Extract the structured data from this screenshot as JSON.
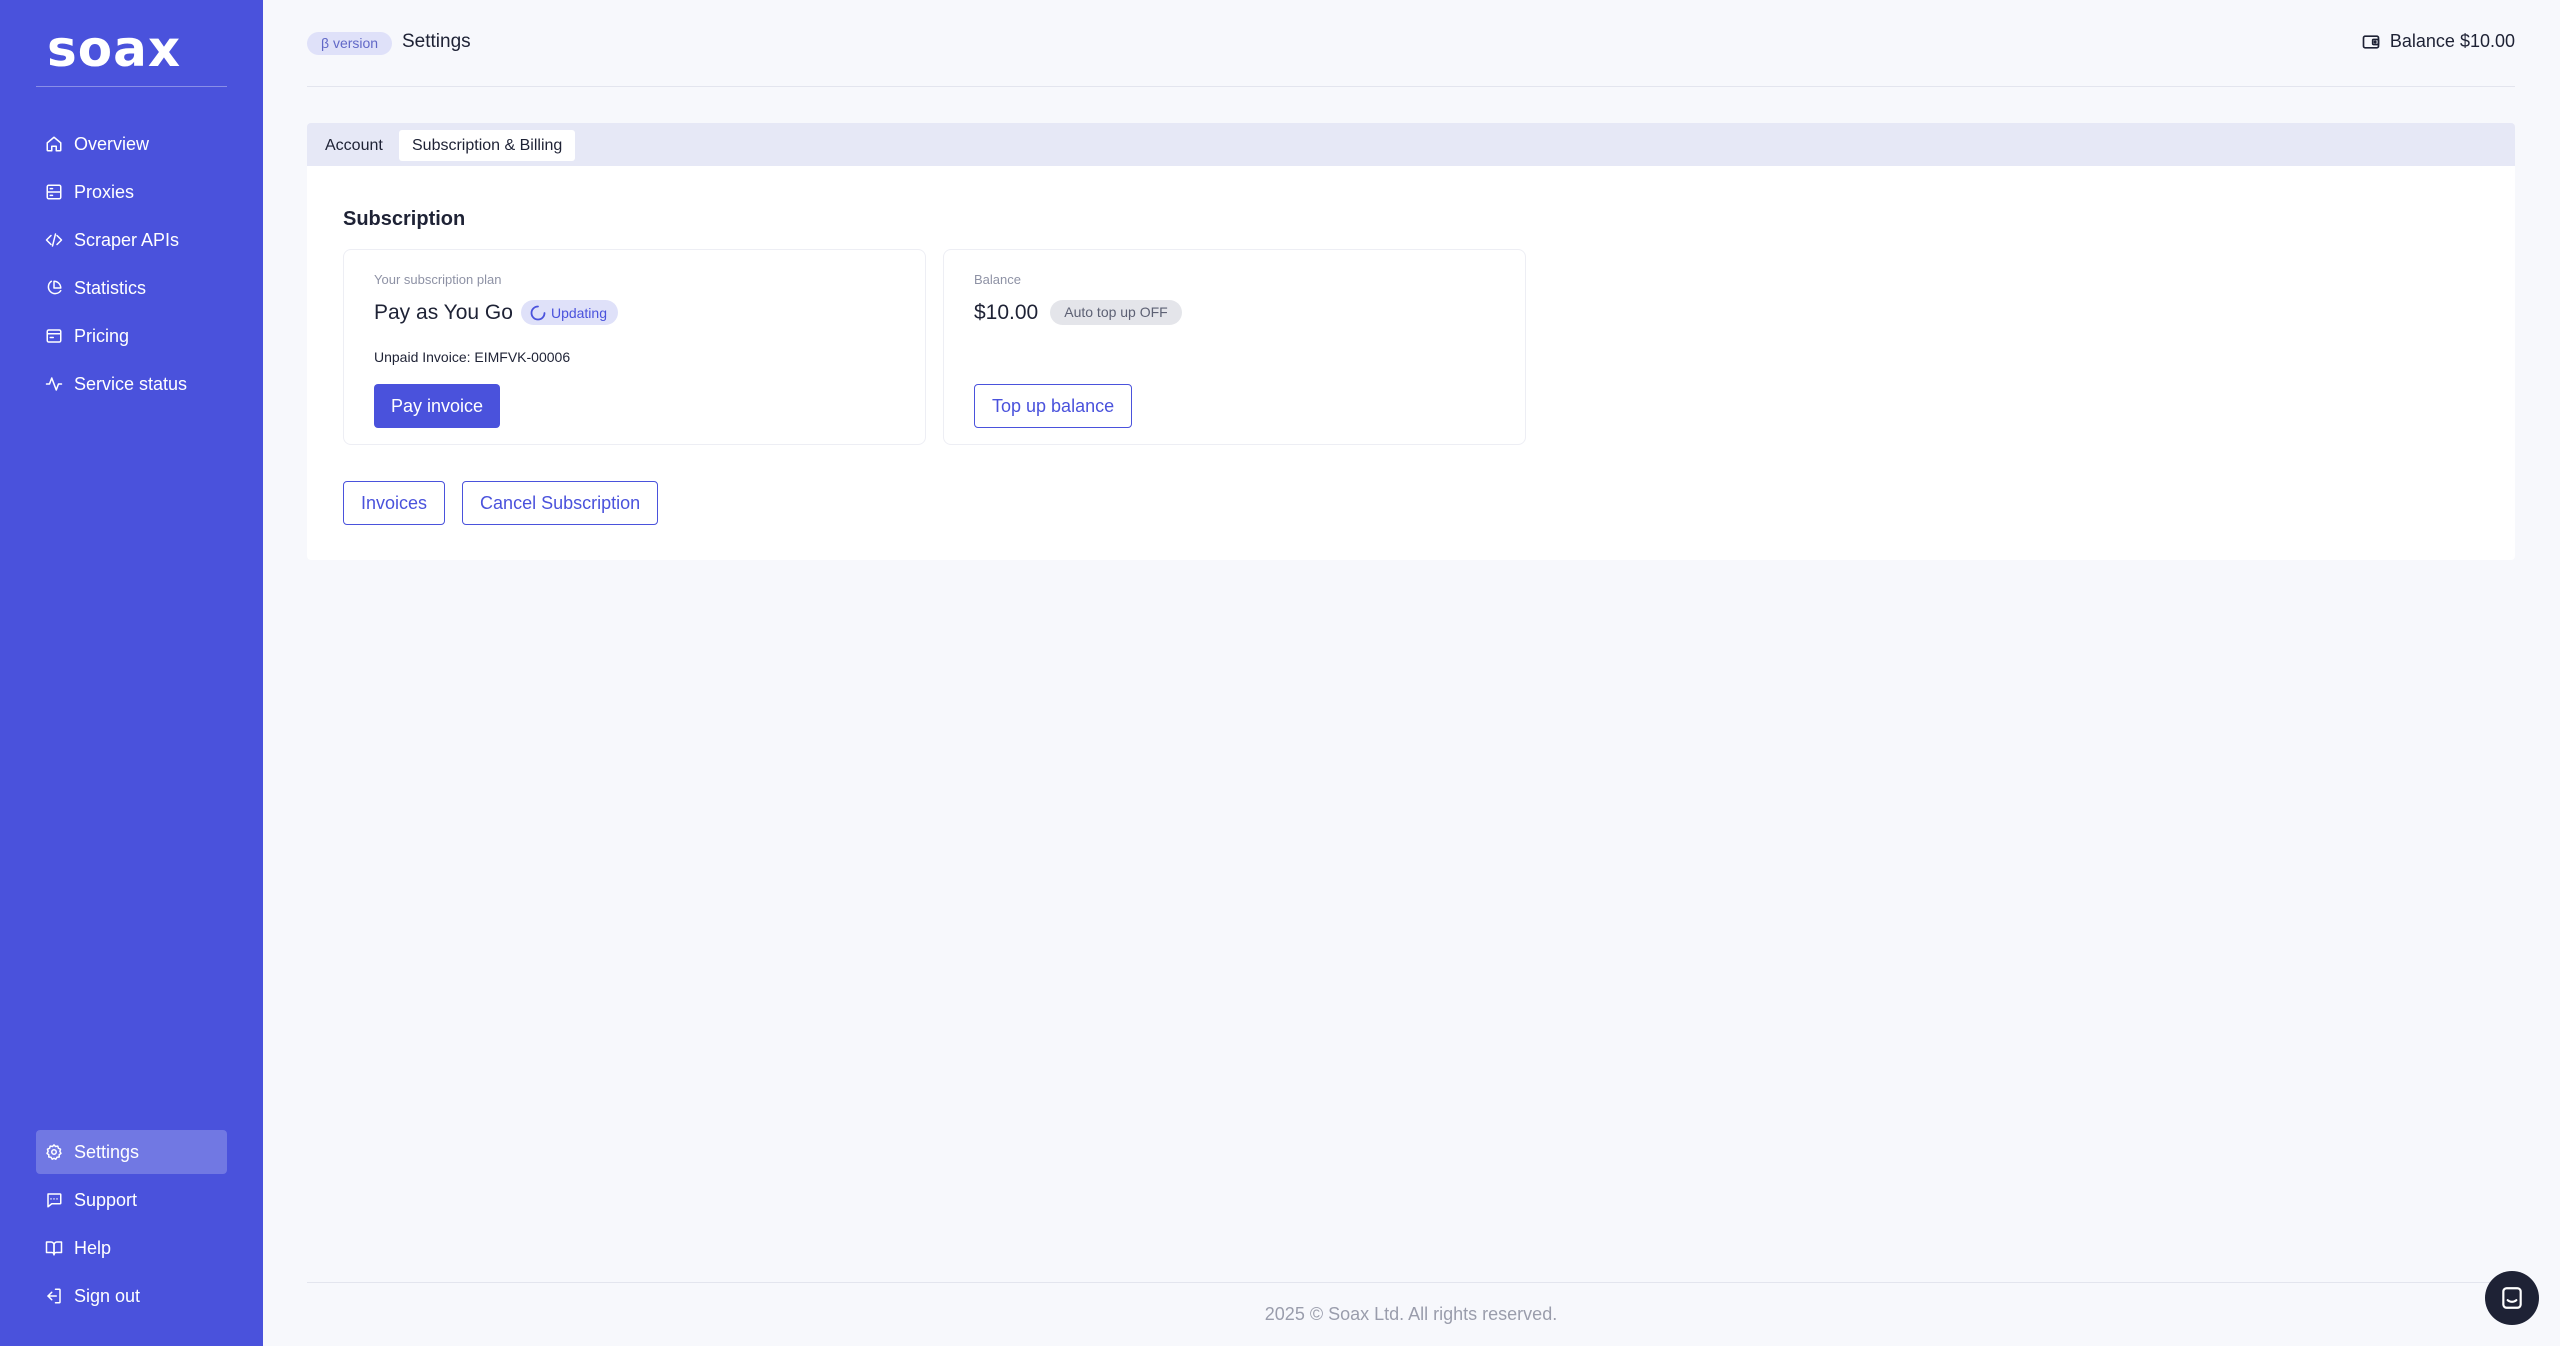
{
  "brand": {
    "logo_text": "soax",
    "sidebar_color": "#4a52dc"
  },
  "sidebar": {
    "items": [
      {
        "label": "Overview",
        "icon": "home-icon"
      },
      {
        "label": "Proxies",
        "icon": "server-icon"
      },
      {
        "label": "Scraper APIs",
        "icon": "code-icon"
      },
      {
        "label": "Statistics",
        "icon": "pie-chart-icon"
      },
      {
        "label": "Pricing",
        "icon": "wallet-icon"
      },
      {
        "label": "Service status",
        "icon": "activity-icon"
      }
    ],
    "bottom_items": [
      {
        "label": "Settings",
        "icon": "gear-icon",
        "active": true
      },
      {
        "label": "Support",
        "icon": "chat-icon"
      },
      {
        "label": "Help",
        "icon": "book-icon"
      },
      {
        "label": "Sign out",
        "icon": "sign-out-icon"
      }
    ]
  },
  "header": {
    "beta_badge": "β version",
    "title": "Settings",
    "balance": "Balance $10.00"
  },
  "tabs": [
    {
      "label": "Account",
      "active": false
    },
    {
      "label": "Subscription & Billing",
      "active": true
    }
  ],
  "subscription": {
    "section_title": "Subscription",
    "plan_card": {
      "label": "Your subscription plan",
      "plan_name": "Pay as You Go",
      "status_badge": "Updating",
      "invoice_text": "Unpaid Invoice: EIMFVK-00006",
      "pay_button": "Pay invoice"
    },
    "balance_card": {
      "label": "Balance",
      "amount": "$10.00",
      "auto_topup_badge": "Auto top up OFF",
      "topup_button": "Top up balance"
    },
    "actions": {
      "invoices_button": "Invoices",
      "cancel_button": "Cancel Subscription"
    }
  },
  "footer": {
    "text": "2025 © Soax Ltd. All rights reserved."
  }
}
